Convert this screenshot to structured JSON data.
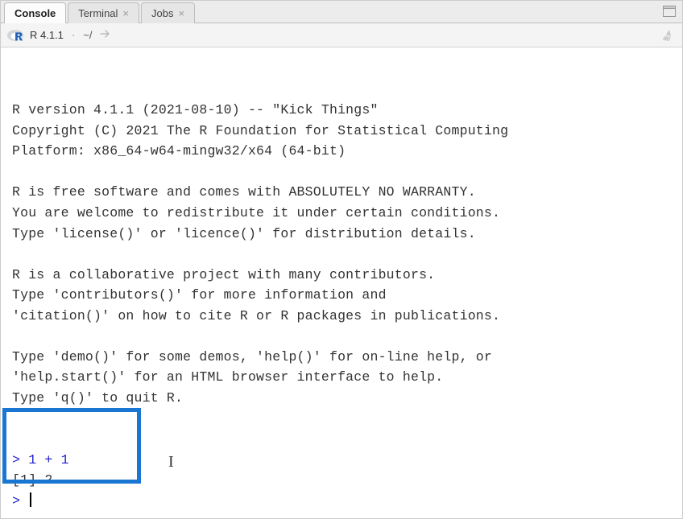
{
  "tabs": {
    "console": "Console",
    "terminal": "Terminal",
    "jobs": "Jobs"
  },
  "info": {
    "version": "R 4.1.1",
    "path": "~/"
  },
  "startup": {
    "l1": "R version 4.1.1 (2021-08-10) -- \"Kick Things\"",
    "l2": "Copyright (C) 2021 The R Foundation for Statistical Computing",
    "l3": "Platform: x86_64-w64-mingw32/x64 (64-bit)",
    "l4": "R is free software and comes with ABSOLUTELY NO WARRANTY.",
    "l5": "You are welcome to redistribute it under certain conditions.",
    "l6": "Type 'license()' or 'licence()' for distribution details.",
    "l7": "R is a collaborative project with many contributors.",
    "l8": "Type 'contributors()' for more information and",
    "l9": "'citation()' on how to cite R or R packages in publications.",
    "l10": "Type 'demo()' for some demos, 'help()' for on-line help, or",
    "l11": "'help.start()' for an HTML browser interface to help.",
    "l12": "Type 'q()' to quit R."
  },
  "session": {
    "prompt": ">",
    "input1": "1 + 1",
    "output1": "[1] 2"
  }
}
